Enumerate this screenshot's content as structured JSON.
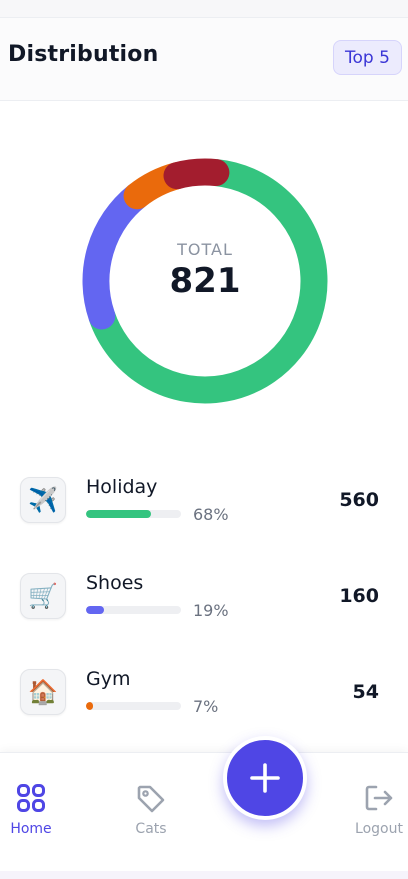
{
  "header": {
    "title": "Distribution",
    "badge": "Top 5"
  },
  "summary": {
    "label": "TOTAL",
    "value": "821"
  },
  "chart_data": {
    "type": "pie",
    "title": "",
    "total": 821,
    "series": [
      {
        "name": "Holiday",
        "value": 560,
        "color": "#34c47f"
      },
      {
        "name": "Shoes",
        "value": 160,
        "color": "#6366f1"
      },
      {
        "name": "Gym",
        "value": 54,
        "color": "#ea6a0c"
      },
      {
        "value": 47,
        "color": "#a31d2e"
      }
    ]
  },
  "categories": [
    {
      "name": "Holiday",
      "icon": "airplane-icon",
      "glyph": "✈️",
      "percent": "68%",
      "fraction": 0.68,
      "value": "560",
      "color": "#34c47f"
    },
    {
      "name": "Shoes",
      "icon": "shopping-cart-icon",
      "glyph": "🛒",
      "percent": "19%",
      "fraction": 0.19,
      "value": "160",
      "color": "#6366f1"
    },
    {
      "name": "Gym",
      "icon": "house-icon",
      "glyph": "🏠",
      "percent": "7%",
      "fraction": 0.07,
      "value": "54",
      "color": "#ea6a0c"
    }
  ],
  "nav": {
    "home": "Home",
    "cats": "Cats",
    "logout": "Logout",
    "active_color": "#4f46e5",
    "inactive_color": "#9ca3af"
  },
  "fab": {
    "icon": "plus-icon"
  }
}
